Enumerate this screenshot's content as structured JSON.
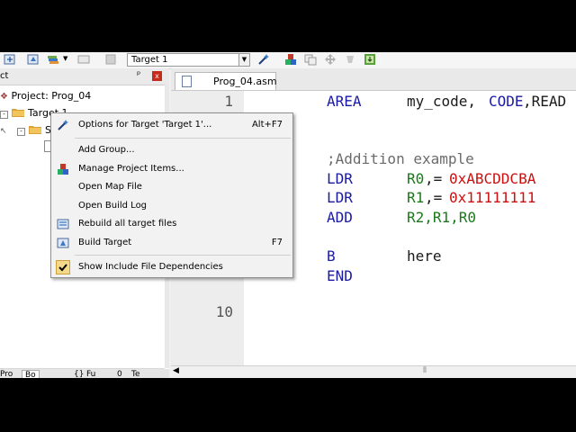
{
  "toolbar": {
    "target_select_value": "Target 1"
  },
  "project_panel": {
    "title": "ct",
    "pin": "ᵖ",
    "close": "x",
    "tree": [
      {
        "label": "Project: Prog_04"
      },
      {
        "label": "Target 1"
      },
      {
        "label": "S"
      }
    ],
    "bottom_tabs": [
      "Pro",
      "Bo",
      "{}",
      "Fu",
      "0",
      "Te"
    ]
  },
  "editor": {
    "tab_label": "Prog_04.asm",
    "line_numbers": [
      "1",
      "10"
    ],
    "code": {
      "l1_kw": "AREA",
      "l1_rest_a": "my_code,",
      "l1_rest_b": "CODE",
      "l1_rest_c": ",READ",
      "comment": ";Addition example",
      "l3_op": "LDR",
      "l3_reg": "R0",
      "l3_eq": ",=",
      "l3_num": "0xABCDDCBA",
      "l4_op": "LDR",
      "l4_reg": "R1",
      "l4_eq": ",=",
      "l4_num": "0x11111111",
      "l5_op": "ADD",
      "l5_reg": "R2,R1,R0",
      "l6_op": "B",
      "l6_arg": "here",
      "l7_op": "END"
    }
  },
  "context_menu": {
    "items": [
      {
        "label": "Options for Target 'Target 1'...",
        "shortcut": "Alt+F7",
        "icon": "options-wand-icon"
      },
      {
        "label": "Add Group...",
        "shortcut": "",
        "icon": ""
      },
      {
        "label": "Manage Project Items...",
        "shortcut": "",
        "icon": "manage-items-icon"
      },
      {
        "label": "Open Map File",
        "shortcut": "",
        "icon": ""
      },
      {
        "label": "Open Build Log",
        "shortcut": "",
        "icon": ""
      },
      {
        "label": "Rebuild all target files",
        "shortcut": "",
        "icon": "rebuild-icon"
      },
      {
        "label": "Build Target",
        "shortcut": "F7",
        "icon": "build-icon"
      },
      {
        "label": "Show Include File Dependencies",
        "shortcut": "",
        "icon": "checkmark-icon",
        "checked": true
      }
    ]
  },
  "colors": {
    "keyword": "#1a1aa6",
    "register": "#1a7a1a",
    "number": "#cc1010",
    "comment": "#6b6b6b",
    "checked_bg": "#f5d98a"
  }
}
